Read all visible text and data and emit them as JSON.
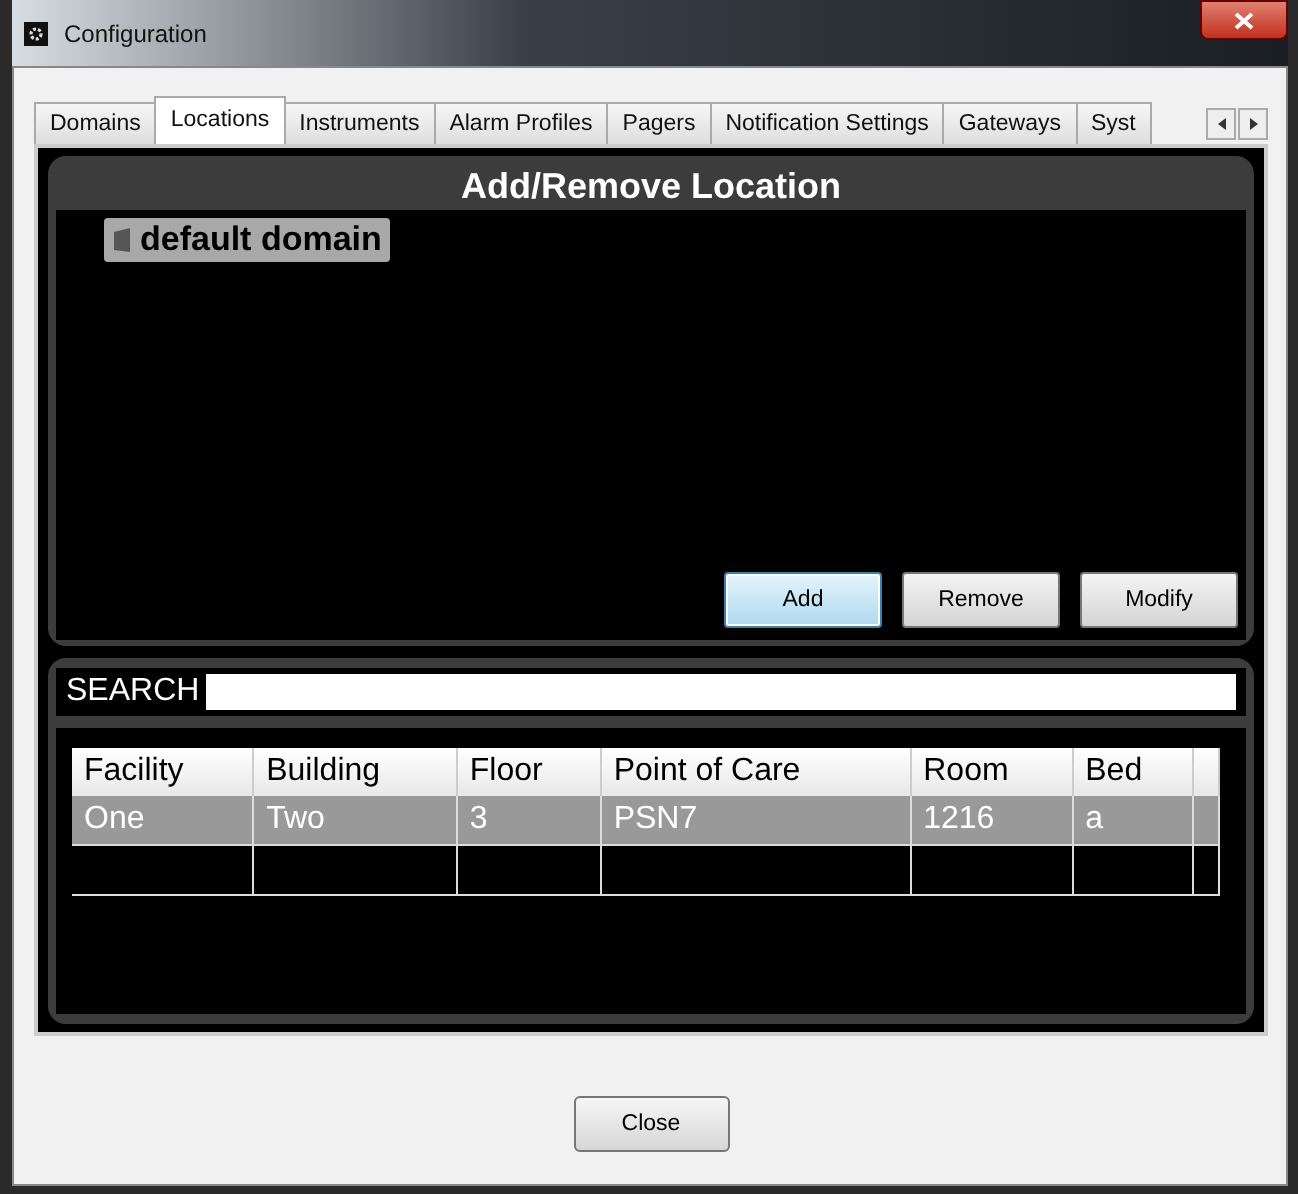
{
  "window": {
    "title": "Configuration"
  },
  "tabs": [
    {
      "label": "Domains",
      "selected": false
    },
    {
      "label": "Locations",
      "selected": true
    },
    {
      "label": "Instruments",
      "selected": false
    },
    {
      "label": "Alarm Profiles",
      "selected": false
    },
    {
      "label": "Pagers",
      "selected": false
    },
    {
      "label": "Notification Settings",
      "selected": false
    },
    {
      "label": "Gateways",
      "selected": false
    },
    {
      "label": "Syst",
      "selected": false
    }
  ],
  "panel": {
    "title": "Add/Remove Location",
    "tree": [
      {
        "label": "default domain",
        "selected": true
      }
    ],
    "buttons": [
      {
        "label": "Add",
        "focused": true
      },
      {
        "label": "Remove",
        "focused": false
      },
      {
        "label": "Modify",
        "focused": false
      }
    ]
  },
  "search": {
    "label": "SEARCH"
  },
  "table": {
    "columns": [
      "Facility",
      "Building",
      "Floor",
      "Point of Care",
      "Room",
      "Bed"
    ],
    "rows": [
      {
        "cells": [
          "One",
          "Two",
          "3",
          "PSN7",
          "1216",
          "a"
        ],
        "selected": true
      }
    ]
  },
  "footer": {
    "button": "Close"
  }
}
